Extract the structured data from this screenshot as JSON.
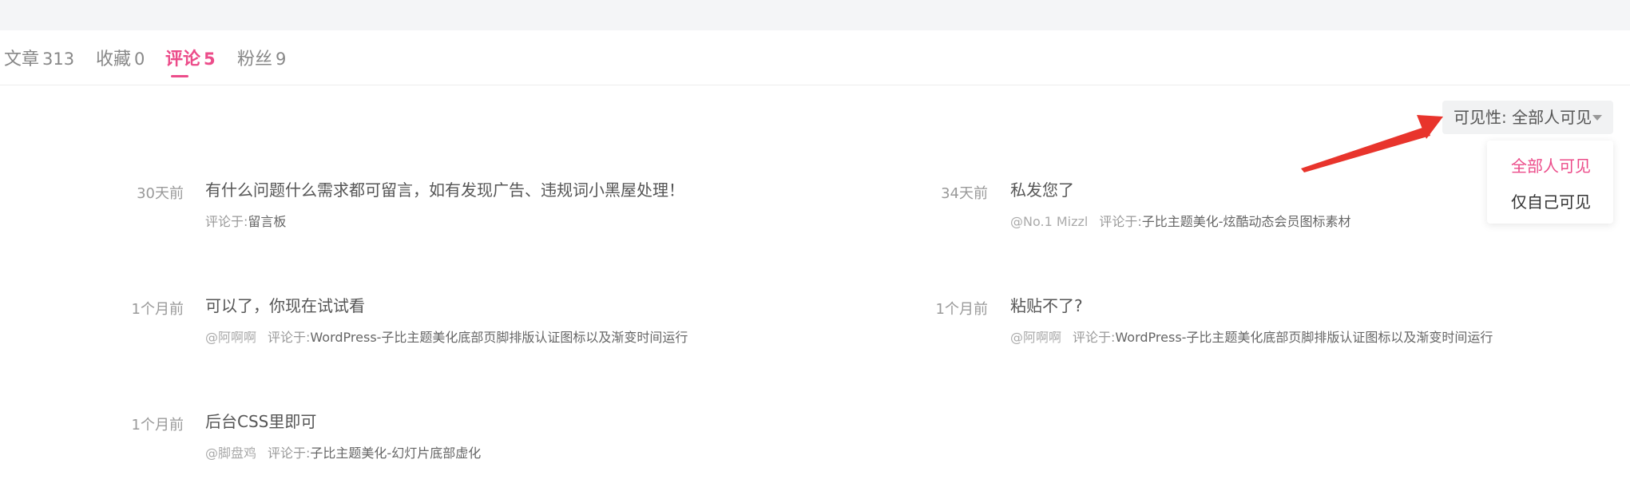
{
  "tabs": [
    {
      "label": "文章",
      "count": "313"
    },
    {
      "label": "收藏",
      "count": "0"
    },
    {
      "label": "评论",
      "count": "5"
    },
    {
      "label": "粉丝",
      "count": "9"
    }
  ],
  "active_tab": "评论",
  "visibility": {
    "button_label": "可见性: 全部人可见",
    "options": [
      "全部人可见",
      "仅自己可见"
    ],
    "selected": "全部人可见"
  },
  "comments": [
    {
      "time": "30天前",
      "text": "有什么问题什么需求都可留言，如有发现广告、违规词小黑屋处理！",
      "user": "",
      "prefix": "评论于:",
      "target": "留言板"
    },
    {
      "time": "34天前",
      "text": "私发您了",
      "user": "@No.1 Mizzl",
      "prefix": "评论于:",
      "target": "子比主题美化-炫酷动态会员图标素材"
    },
    {
      "time": "1个月前",
      "text": "可以了，你现在试试看",
      "user": "@阿啊啊",
      "prefix": "评论于:",
      "target": "WordPress-子比主题美化底部页脚排版认证图标以及渐变时间运行"
    },
    {
      "time": "1个月前",
      "text": "粘贴不了?",
      "user": "@阿啊啊",
      "prefix": "评论于:",
      "target": "WordPress-子比主题美化底部页脚排版认证图标以及渐变时间运行"
    },
    {
      "time": "1个月前",
      "text": "后台CSS里即可",
      "user": "@脚盘鸡",
      "prefix": "评论于:",
      "target": "子比主题美化-幻灯片底部虚化"
    }
  ],
  "colors": {
    "accent": "#ec4c8a",
    "arrow": "#e8342c",
    "muted": "#999999"
  }
}
